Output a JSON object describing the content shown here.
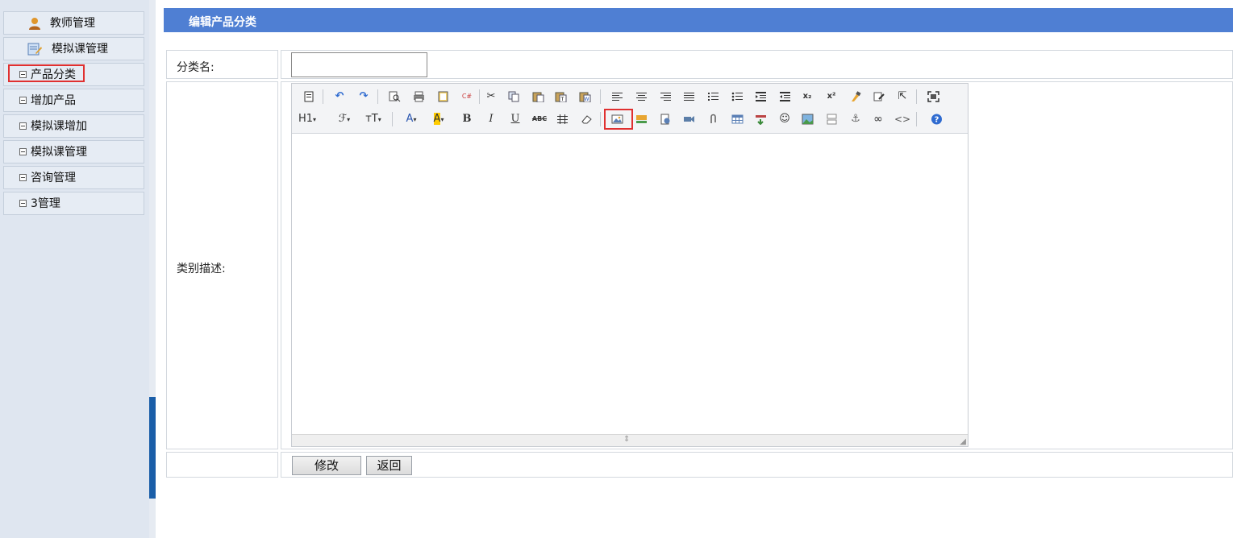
{
  "sidebar": {
    "items": [
      {
        "label": "教师管理"
      },
      {
        "label": "模拟课管理"
      },
      {
        "label": "产品分类"
      },
      {
        "label": "增加产品"
      },
      {
        "label": "模拟课增加"
      },
      {
        "label": "模拟课管理"
      },
      {
        "label": "咨询管理"
      },
      {
        "label": "3管理"
      }
    ]
  },
  "page": {
    "title": "编辑产品分类"
  },
  "form": {
    "name_label": "分类名:",
    "name_value": "",
    "desc_label": "类别描述:",
    "submit_label": "修改",
    "back_label": "返回"
  },
  "toolbar": {
    "row2_text": {
      "h1": "H1",
      "font": "ℱ",
      "size": "тT",
      "color": "A",
      "bg": "A",
      "bold": "B",
      "italic": "I",
      "underline": "U",
      "strike": "ABC"
    }
  },
  "colors": {
    "title_bar": "#4f7fd3",
    "sidebar_bg": "#dfe6f0",
    "highlight": "#e03030",
    "splitter_handle": "#1a5ea8"
  }
}
